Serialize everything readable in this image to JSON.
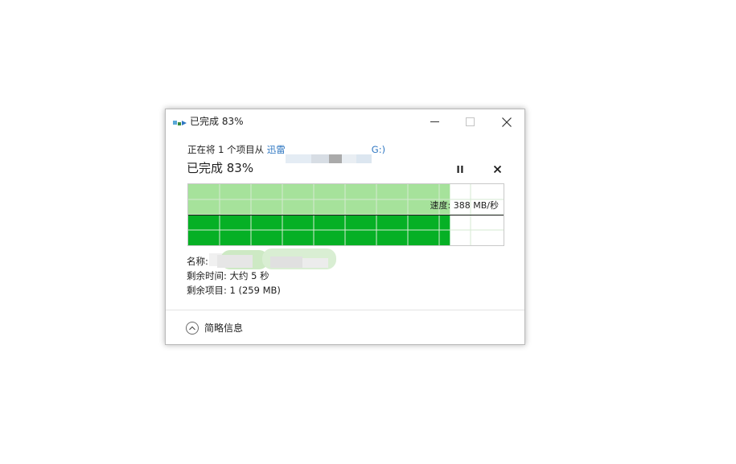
{
  "window": {
    "title": "已完成 83%",
    "controls": [
      "minimize-icon",
      "maximize-icon",
      "close-icon"
    ]
  },
  "copy": {
    "from_prefix": "正在将 1 个项目从 ",
    "source_name_visible": "迅雷",
    "source_drive": "G:)",
    "status_heading": "已完成 83%",
    "progress_fraction": 0.83,
    "speed_label": "速度: 388 MB/秒",
    "name_label": "名称:",
    "time_remaining": "剩余时间: 大约 5 秒",
    "items_remaining": "剩余项目: 1 (259 MB)",
    "details_label": "简略信息"
  },
  "colors": {
    "progress_fill": "#06b025",
    "progress_history": "#a6e29b",
    "grid_line": "#d6ead2",
    "link": "#2f77c2"
  }
}
